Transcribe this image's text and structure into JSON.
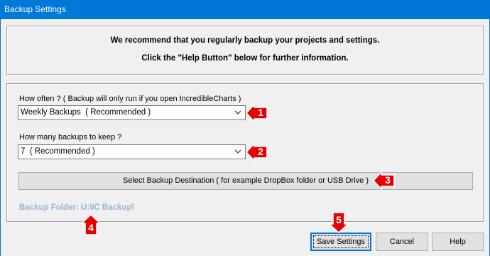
{
  "window": {
    "title": "Backup Settings"
  },
  "notice": {
    "line1": "We recommend that you regularly backup your projects and settings.",
    "line2": "Click the \"Help Button\" below for further information."
  },
  "frequency": {
    "label": "How often ? ( Backup will only run if you open IncredibleCharts )",
    "selected": "Weekly Backups  ( Recommended )"
  },
  "retention": {
    "label": "How many backups to keep ?",
    "selected": "7  ( Recommended )"
  },
  "destination_button": {
    "label": "Select Backup Destination  ( for example DropBox folder or USB Drive )"
  },
  "folder": {
    "text": "Backup Folder: U:\\IC Backup\\"
  },
  "buttons": {
    "save": "Save Settings",
    "cancel": "Cancel",
    "help": "Help"
  },
  "callouts": [
    "1",
    "2",
    "3",
    "4",
    "5"
  ],
  "colors": {
    "titlebar": "#0078d7",
    "callout": "#e60000",
    "folder_text": "#99b4d1"
  }
}
